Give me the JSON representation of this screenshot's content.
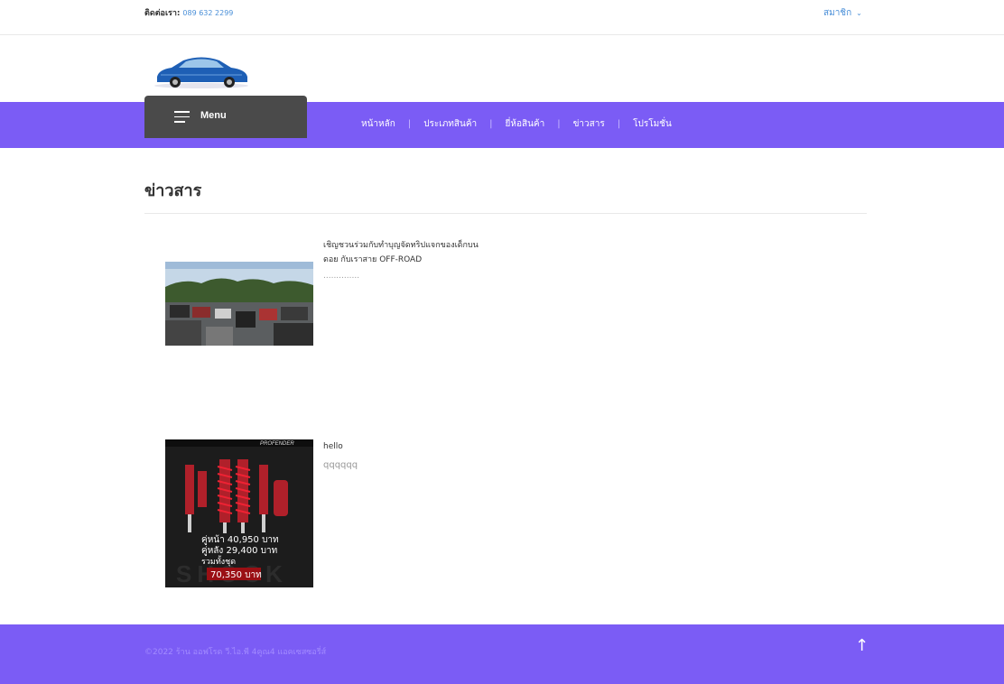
{
  "header": {
    "contact_label": "ติดต่อเรา:",
    "contact_phone": "089 632 2299",
    "member_label": "สมาชิก"
  },
  "nav": {
    "menu_label": "Menu",
    "items": [
      "หน้าหลัก",
      "ประเภทสินค้า",
      "ยี่ห้อสินค้า",
      "ข่าวสาร",
      "โปรโมชั่น"
    ]
  },
  "page": {
    "title": "ข่าวสาร"
  },
  "news": [
    {
      "title_line1": "เชิญชวนร่วมกับทำบุญจัดทริปแจกของเด็กบน",
      "title_line2": "ดอย กับเราสาย OFF-ROAD",
      "desc": "..............",
      "image": "offroad-trip-photo"
    },
    {
      "title_line1": "hello",
      "desc": "qqqqqq",
      "image": "shock-absorber-promo",
      "img_brand": "PROFENDER",
      "img_front": "คู่หน้า 40,950 บาท",
      "img_rear": "คู่หลัง 29,400 บาท",
      "img_total_label": "รวมทั้งชุด",
      "img_total": "70,350 บาท",
      "img_watermark": "SHOCK"
    }
  ],
  "footer": {
    "copyright": "©2022 ร้าน ออฟโรด วี.ไอ.พี 4คูณ4 แอคเซสซอรี่ส์",
    "to_top_icon": "arrow-up-icon"
  },
  "colors": {
    "accent": "#7b5cf5",
    "menu_bg": "#4a4a4a",
    "link": "#4a8fd8"
  }
}
